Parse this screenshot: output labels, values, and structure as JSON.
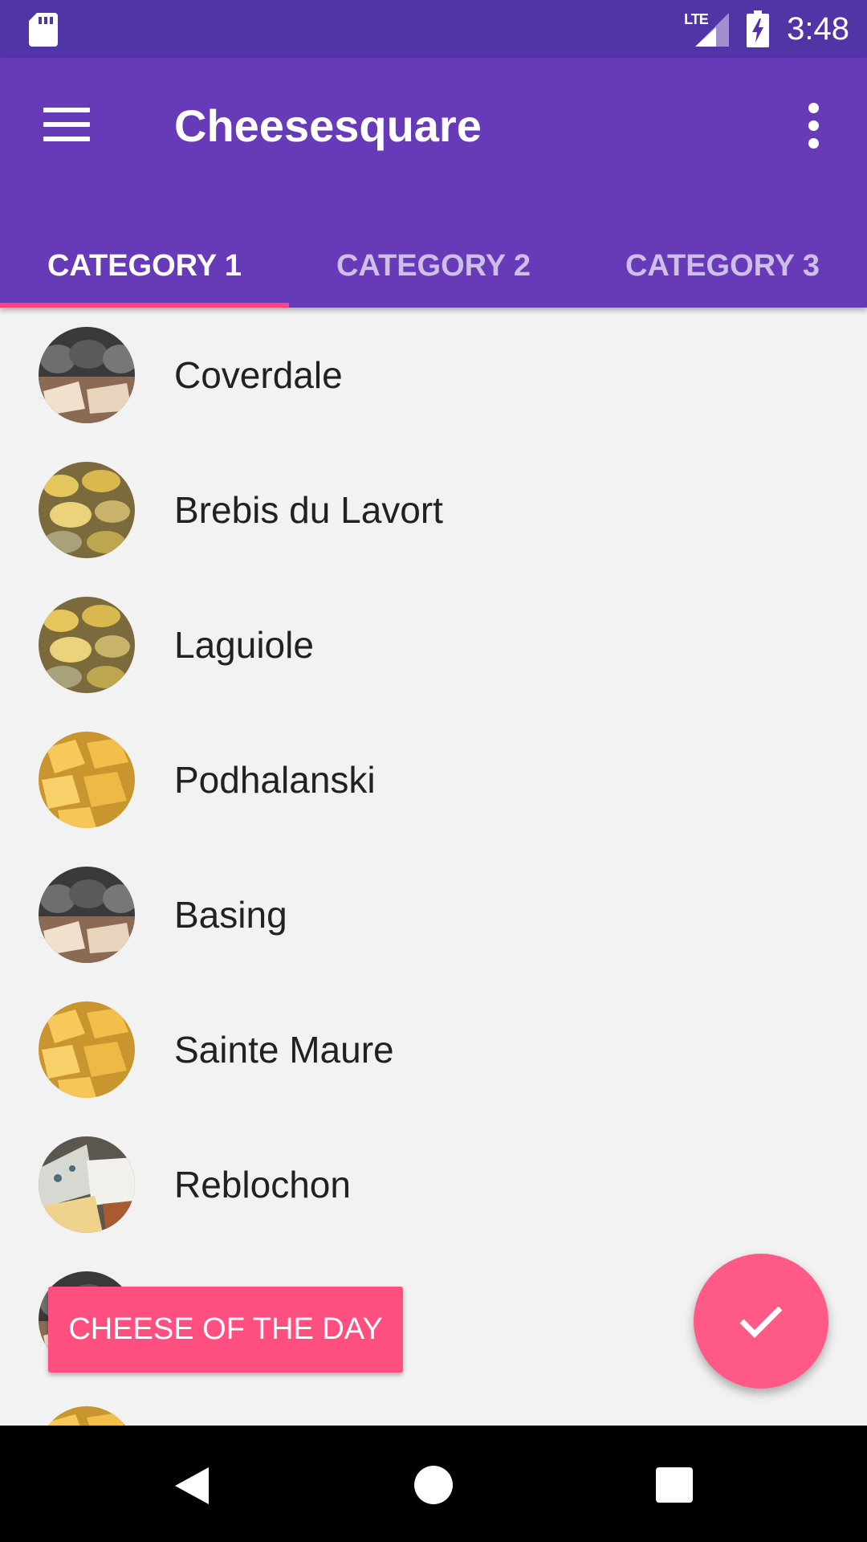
{
  "status_bar": {
    "network": "LTE",
    "time": "3:48",
    "icons": [
      "sd-card-icon",
      "lte-signal-icon",
      "battery-charging-icon"
    ]
  },
  "app_bar": {
    "title": "Cheesesquare",
    "icons": [
      "menu-icon",
      "overflow-menu-icon"
    ],
    "background": "#673ab7"
  },
  "tabs": [
    {
      "label": "CATEGORY 1",
      "selected": true
    },
    {
      "label": "CATEGORY 2",
      "selected": false
    },
    {
      "label": "CATEGORY 3",
      "selected": false
    }
  ],
  "accent_color": "#ff4081",
  "cheeses": [
    {
      "name": "Coverdale",
      "image": "cheese-dark-wheels"
    },
    {
      "name": "Brebis du Lavort",
      "image": "cheese-round-wheels"
    },
    {
      "name": "Laguiole",
      "image": "cheese-round-wheels"
    },
    {
      "name": "Podhalanski",
      "image": "cheese-cubes"
    },
    {
      "name": "Basing",
      "image": "cheese-dark-wheels"
    },
    {
      "name": "Sainte Maure",
      "image": "cheese-cubes"
    },
    {
      "name": "Reblochon",
      "image": "cheese-blue-wedges"
    },
    {
      "name": "",
      "image": "cheese-dark-wheels"
    },
    {
      "name": "",
      "image": "cheese-cubes"
    }
  ],
  "snackbar": {
    "text": "CHEESE OF THE DAY"
  },
  "fab": {
    "icon": "check-icon"
  },
  "nav_bar": {
    "icons": [
      "back-icon",
      "home-icon",
      "recents-icon"
    ]
  }
}
